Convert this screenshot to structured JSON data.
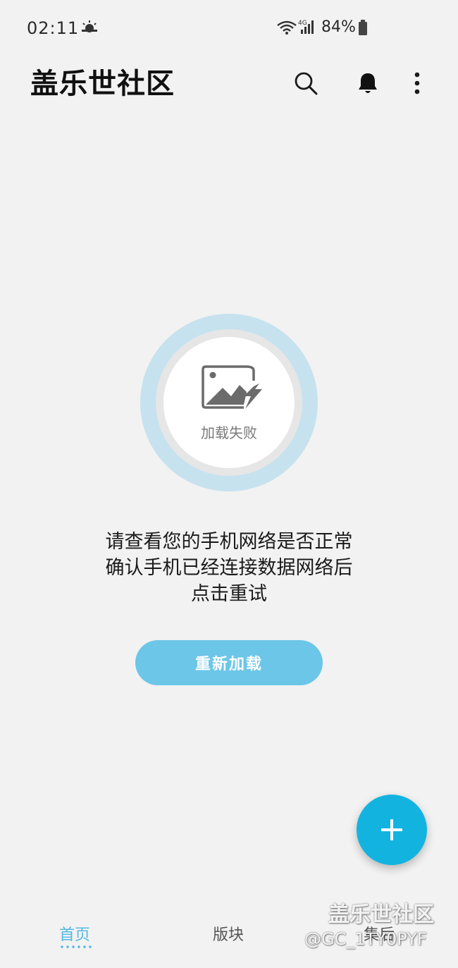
{
  "status_bar": {
    "time": "02:11",
    "network_type": "4G",
    "battery": "84%"
  },
  "app_bar": {
    "title": "盖乐世社区",
    "icons": [
      "search-icon",
      "bell-icon",
      "more-vert-icon"
    ]
  },
  "error": {
    "image_label": "加载失败",
    "message_lines": [
      "请查看您的手机网络是否正常",
      "确认手机已经连接数据网络后",
      "点击重试"
    ],
    "reload_label": "重新加载"
  },
  "fab": {
    "icon": "plus-icon"
  },
  "bottom_nav": {
    "items": [
      {
        "label": "首页",
        "active": true
      },
      {
        "label": "版块",
        "active": false
      },
      {
        "label": "集后",
        "active": false
      }
    ]
  },
  "watermark": {
    "brand": "盖乐世社区",
    "user": "@GC_1TY0PYF"
  },
  "colors": {
    "accent": "#55b8e2",
    "fab": "#13b3e0",
    "button": "#6cc6e8",
    "background": "#f2f2f2"
  }
}
